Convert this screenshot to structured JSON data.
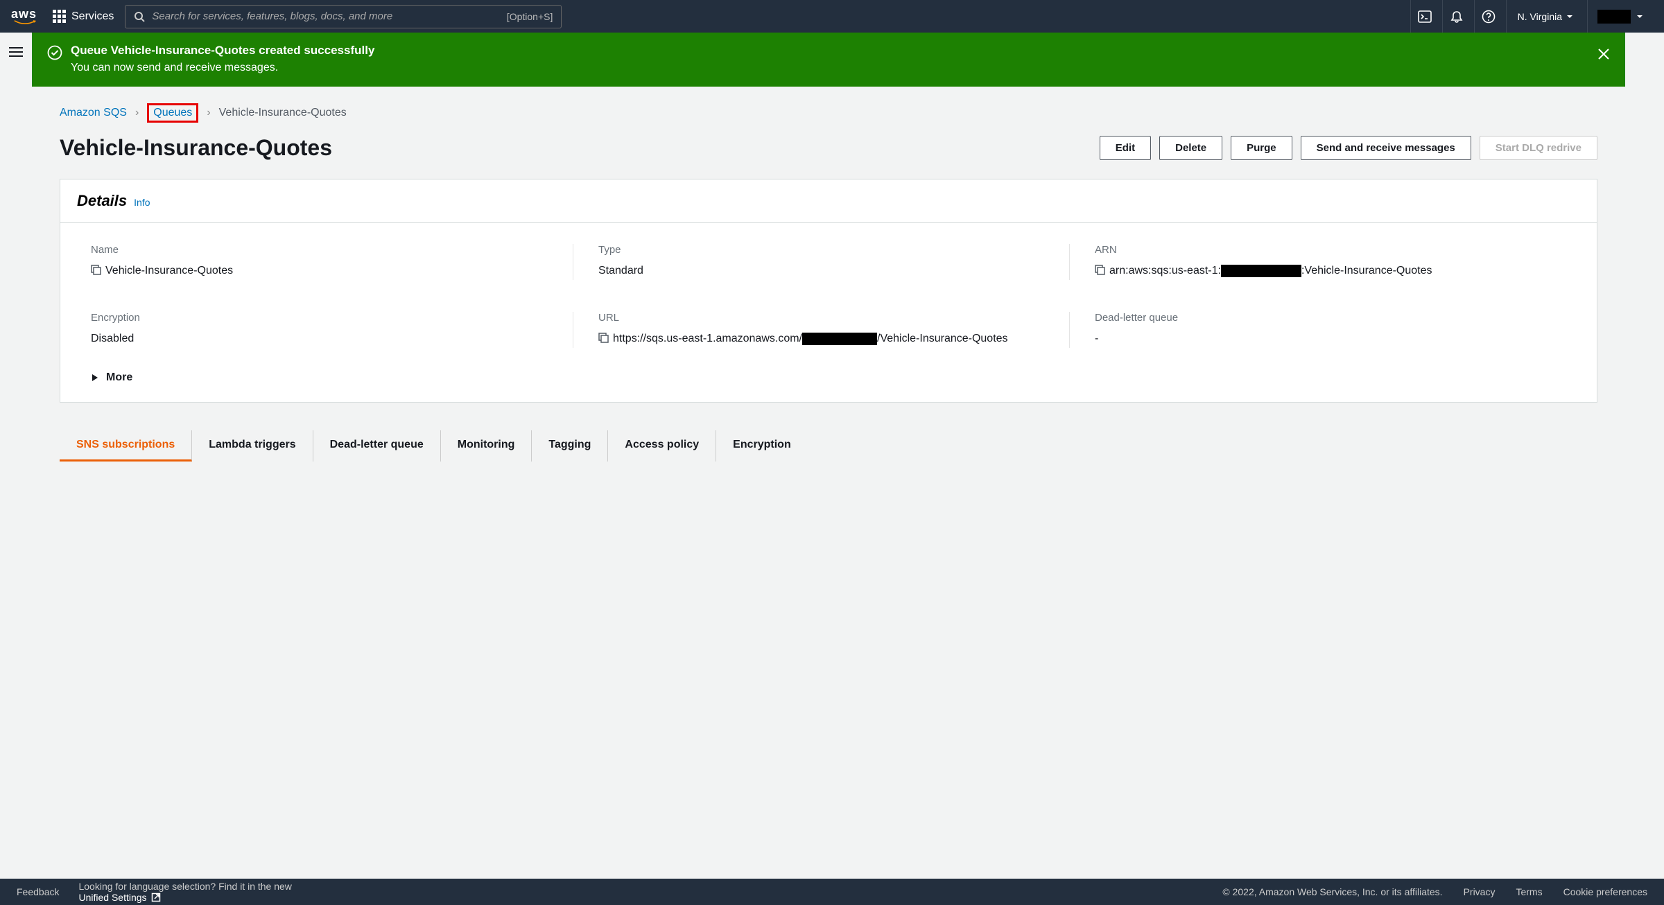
{
  "nav": {
    "services_label": "Services",
    "search_placeholder": "Search for services, features, blogs, docs, and more",
    "search_shortcut": "[Option+S]",
    "region": "N. Virginia"
  },
  "banner": {
    "title": "Queue Vehicle-Insurance-Quotes created successfully",
    "subtitle": "You can now send and receive messages."
  },
  "breadcrumb": {
    "service": "Amazon SQS",
    "level1": "Queues",
    "current": "Vehicle-Insurance-Quotes"
  },
  "page": {
    "title": "Vehicle-Insurance-Quotes",
    "actions": {
      "edit": "Edit",
      "delete": "Delete",
      "purge": "Purge",
      "send_receive": "Send and receive messages",
      "dlq": "Start DLQ redrive"
    }
  },
  "details": {
    "heading": "Details",
    "info": "Info",
    "name_label": "Name",
    "name_value": "Vehicle-Insurance-Quotes",
    "type_label": "Type",
    "type_value": "Standard",
    "arn_label": "ARN",
    "arn_prefix": "arn:aws:sqs:us-east-1:",
    "arn_suffix": ":Vehicle-Insurance-Quotes",
    "encryption_label": "Encryption",
    "encryption_value": "Disabled",
    "url_label": "URL",
    "url_prefix": "https://sqs.us-east-1.amazonaws.com/",
    "url_suffix": "/Vehicle-Insurance-Quotes",
    "dlq_label": "Dead-letter queue",
    "dlq_value": "-",
    "more": "More"
  },
  "tabs": [
    "SNS subscriptions",
    "Lambda triggers",
    "Dead-letter queue",
    "Monitoring",
    "Tagging",
    "Access policy",
    "Encryption"
  ],
  "footer": {
    "feedback": "Feedback",
    "lang_hint": "Looking for language selection? Find it in the new ",
    "unified": "Unified Settings",
    "copyright": "© 2022, Amazon Web Services, Inc. or its affiliates.",
    "privacy": "Privacy",
    "terms": "Terms",
    "cookies": "Cookie preferences"
  }
}
